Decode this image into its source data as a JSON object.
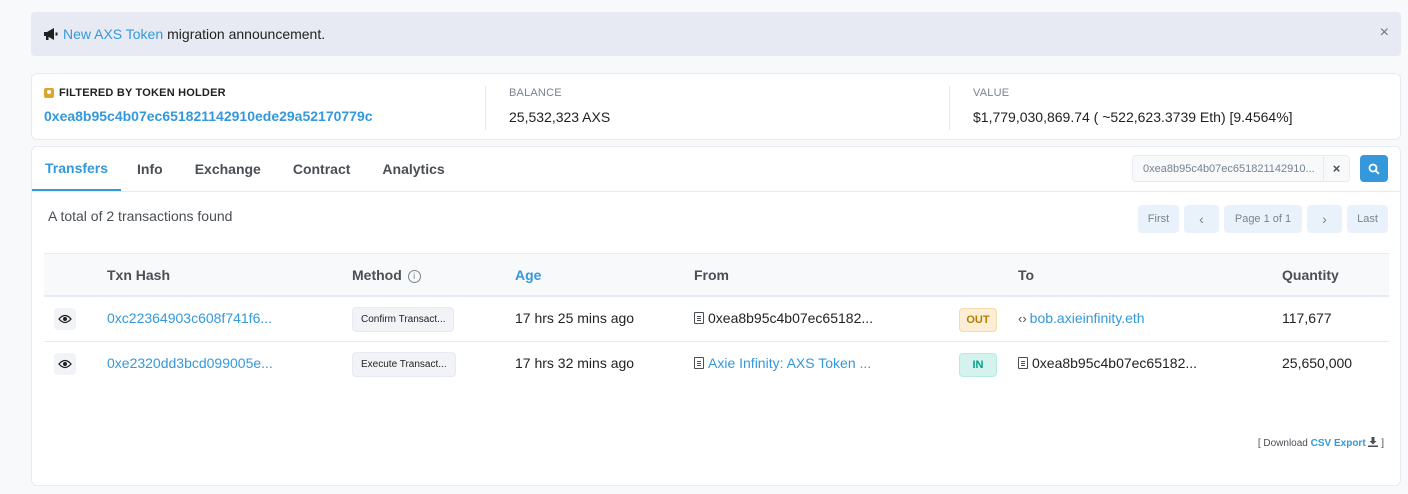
{
  "announcement": {
    "link_text": "New AXS Token",
    "text": "migration announcement.",
    "close": "×"
  },
  "summary": {
    "holder_label": "FILTERED BY TOKEN HOLDER",
    "holder_address": "0xea8b95c4b07ec651821142910ede29a52170779c",
    "balance_label": "BALANCE",
    "balance_value": "25,532,323 AXS",
    "value_label": "VALUE",
    "value_value": "$1,779,030,869.74 ( ~522,623.3739 Eth) [9.4564%]"
  },
  "tabs": [
    {
      "label": "Transfers",
      "active": true
    },
    {
      "label": "Info"
    },
    {
      "label": "Exchange"
    },
    {
      "label": "Contract"
    },
    {
      "label": "Analytics"
    }
  ],
  "search": {
    "value": "0xea8b95c4b07ec651821142910...",
    "clear": "×"
  },
  "results": {
    "found_text": "A total of 2 transactions found"
  },
  "pager": {
    "first": "First",
    "prev": "‹",
    "page": "Page 1 of 1",
    "next": "›",
    "last": "Last"
  },
  "table": {
    "headers": {
      "txn_hash": "Txn Hash",
      "method": "Method",
      "age": "Age",
      "from": "From",
      "to": "To",
      "quantity": "Quantity"
    },
    "rows": [
      {
        "txn_hash": "0xc22364903c608f741f6...",
        "method": "Confirm Transact...",
        "age": "17 hrs 25 mins ago",
        "from": "0xea8b95c4b07ec65182...",
        "direction": "OUT",
        "to": "bob.axieinfinity.eth",
        "quantity": "117,677"
      },
      {
        "txn_hash": "0xe2320dd3bcd099005e...",
        "method": "Execute Transact...",
        "age": "17 hrs 32 mins ago",
        "from": "Axie Infinity: AXS Token ...",
        "direction": "IN",
        "to": "0xea8b95c4b07ec65182...",
        "quantity": "25,650,000"
      }
    ]
  },
  "csv": {
    "prefix": "[ Download",
    "link": "CSV Export",
    "suffix": "]"
  },
  "colors": {
    "accent": "#3498db",
    "out_badge": "#fbeed5",
    "in_badge": "#d4f3ee"
  }
}
